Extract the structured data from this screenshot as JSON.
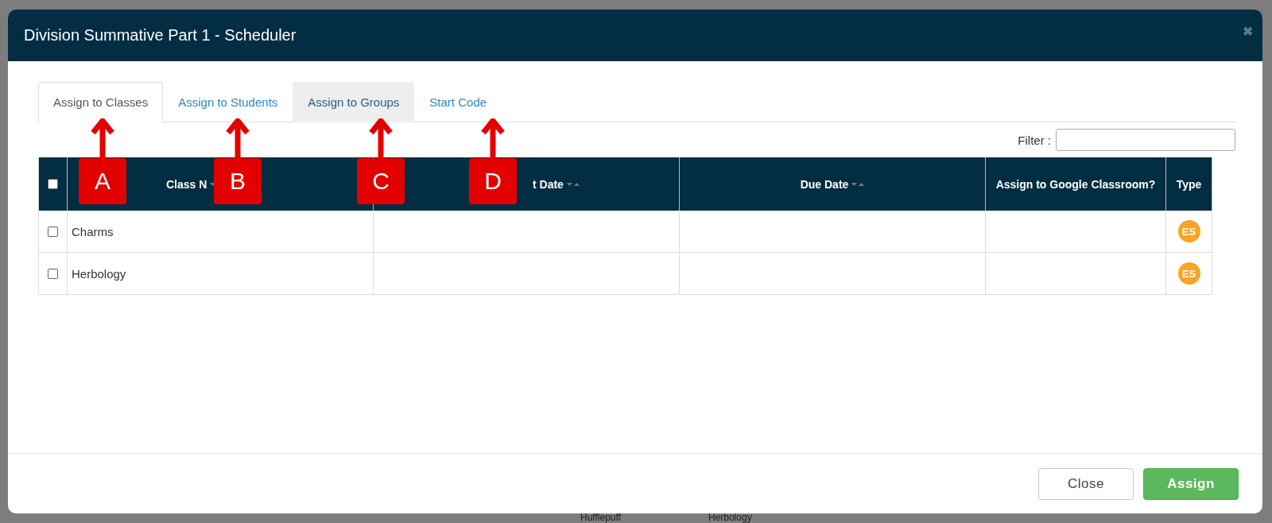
{
  "backdrop": {
    "texts": [
      "Hufflepuff",
      "Herbology"
    ]
  },
  "dialog": {
    "title": "Division Summative Part 1 - Scheduler",
    "close_icon": "✖"
  },
  "tabs": [
    {
      "label": "Assign to Classes",
      "selected": true,
      "hovered": false
    },
    {
      "label": "Assign to Students",
      "selected": false,
      "hovered": false
    },
    {
      "label": "Assign to Groups",
      "selected": false,
      "hovered": true
    },
    {
      "label": "Start Code",
      "selected": false,
      "hovered": false
    }
  ],
  "filter": {
    "label": "Filter :"
  },
  "table": {
    "select_all": {
      "checked": false
    },
    "columns": [
      {
        "label": "Class N",
        "sortable": true
      },
      {
        "label": "t Date",
        "sortable": true
      },
      {
        "label": "Due Date",
        "sortable": true
      },
      {
        "label": "Assign to Google Classroom?",
        "sortable": false
      },
      {
        "label": "Type",
        "sortable": false
      }
    ],
    "rows": [
      {
        "checked": false,
        "class_name": "Charms",
        "type": "ES"
      },
      {
        "checked": false,
        "class_name": "Herbology",
        "type": "ES"
      }
    ]
  },
  "callouts": [
    {
      "label": "A"
    },
    {
      "label": "B"
    },
    {
      "label": "C"
    },
    {
      "label": "D"
    }
  ],
  "buttons": [
    {
      "label": "Close",
      "kind": "default"
    },
    {
      "label": "Assign",
      "kind": "primary"
    }
  ]
}
